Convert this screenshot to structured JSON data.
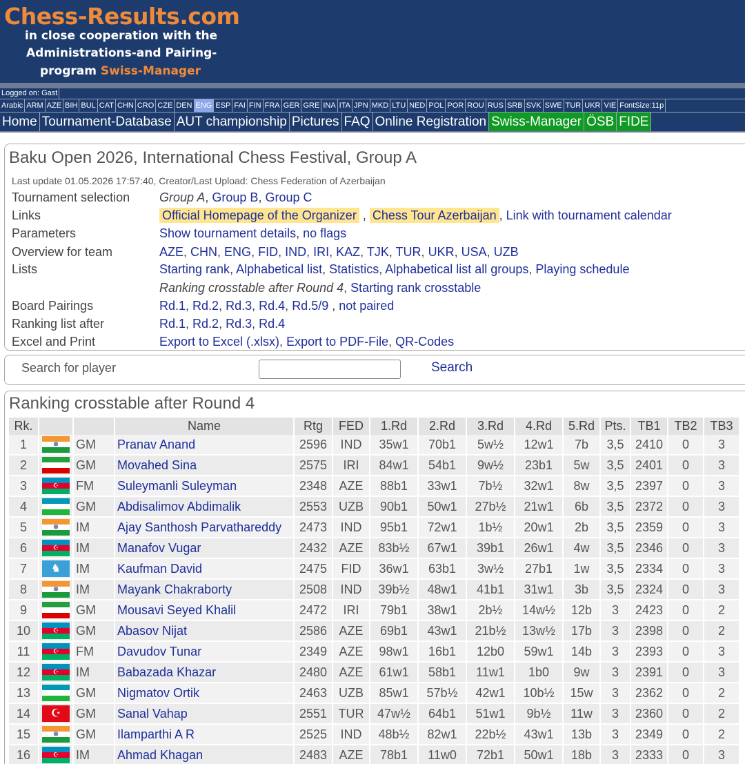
{
  "header": {
    "logo_title": "Chess-Results.com",
    "logo_line1": "in close cooperation with the",
    "logo_line2": "Administrations-and Pairing-",
    "logo_line3a": "program ",
    "logo_line3b": "Swiss-Manager"
  },
  "logon": "Logged on: Gast",
  "languages": [
    "Arabic",
    "ARM",
    "AZE",
    "BIH",
    "BUL",
    "CAT",
    "CHN",
    "CRO",
    "CZE",
    "DEN",
    "ENG",
    "ESP",
    "FAI",
    "FIN",
    "FRA",
    "GER",
    "GRE",
    "INA",
    "ITA",
    "JPN",
    "MKD",
    "LTU",
    "NED",
    "POL",
    "POR",
    "ROU",
    "RUS",
    "SRB",
    "SVK",
    "SWE",
    "TUR",
    "UKR",
    "VIE",
    "FontSize:11p"
  ],
  "active_language": "ENG",
  "menu": [
    "Home",
    "Tournament-Database",
    "AUT championship",
    "Pictures",
    "FAQ",
    "Online Registration",
    "Swiss-Manager",
    "ÖSB",
    "FIDE"
  ],
  "menu_green": [
    "Swiss-Manager",
    "ÖSB",
    "FIDE"
  ],
  "tournament": {
    "name": "Baku Open 2026, International Chess Festival, Group A",
    "last_update": "Last update 01.05.2026 17:57:40, Creator/Last Upload: Chess Federation of Azerbaijan",
    "rows": [
      {
        "label": "Tournament selection"
      },
      {
        "label": "Links"
      },
      {
        "label": "Parameters"
      },
      {
        "label": "Overview for team"
      },
      {
        "label": "Lists"
      },
      {
        "label": ""
      },
      {
        "label": "Board Pairings"
      },
      {
        "label": "Ranking list after"
      },
      {
        "label": "Excel and Print"
      }
    ],
    "selection_current": "Group A",
    "selection_links": [
      "Group B",
      "Group C"
    ],
    "links_highlight": [
      "Official Homepage of the Organizer",
      "Chess Tour Azerbaijan"
    ],
    "links_plain": "Link with tournament calendar",
    "parameters": [
      "Show tournament details",
      "no flags"
    ],
    "teams": [
      "AZE",
      "CHN",
      "ENG",
      "FID",
      "IND",
      "IRI",
      "KAZ",
      "TJK",
      "TUR",
      "UKR",
      "USA",
      "UZB"
    ],
    "lists": [
      "Starting rank",
      "Alphabetical list",
      "Statistics",
      "Alphabetical list all groups",
      "Playing schedule"
    ],
    "lists2_current": "Ranking crosstable after Round 4",
    "lists2_link": "Starting rank crosstable",
    "pairings": [
      "Rd.1",
      "Rd.2",
      "Rd.3",
      "Rd.4",
      "Rd.5/9"
    ],
    "pairings_extra": "not paired",
    "ranking_after": [
      "Rd.1",
      "Rd.2",
      "Rd.3",
      "Rd.4"
    ],
    "excel": [
      "Export to Excel (.xlsx)",
      "Export to PDF-File",
      "QR-Codes"
    ]
  },
  "search": {
    "label": "Search for player",
    "button": "Search",
    "value": ""
  },
  "crosstable": {
    "title": "Ranking crosstable after Round 4",
    "headers": [
      "Rk.",
      "",
      "",
      "Name",
      "Rtg",
      "FED",
      "1.Rd",
      "2.Rd",
      "3.Rd",
      "4.Rd",
      "5.Rd",
      "Pts.",
      "TB1",
      "TB2",
      "TB3"
    ],
    "rows": [
      {
        "rk": "1",
        "title": "GM",
        "name": "Pranav Anand",
        "rtg": "2596",
        "fed": "IND",
        "r1": "35w1",
        "r2": "70b1",
        "r3": "5w½",
        "r4": "12w1",
        "r5": "7b",
        "pts": "3,5",
        "tb1": "2410",
        "tb2": "0",
        "tb3": "3"
      },
      {
        "rk": "2",
        "title": "GM",
        "name": "Movahed Sina",
        "rtg": "2575",
        "fed": "IRI",
        "r1": "84w1",
        "r2": "54b1",
        "r3": "9w½",
        "r4": "23b1",
        "r5": "5w",
        "pts": "3,5",
        "tb1": "2401",
        "tb2": "0",
        "tb3": "3"
      },
      {
        "rk": "3",
        "title": "FM",
        "name": "Suleymanli Suleyman",
        "rtg": "2348",
        "fed": "AZE",
        "r1": "88b1",
        "r2": "33w1",
        "r3": "7b½",
        "r4": "32w1",
        "r5": "8w",
        "pts": "3,5",
        "tb1": "2397",
        "tb2": "0",
        "tb3": "3"
      },
      {
        "rk": "4",
        "title": "GM",
        "name": "Abdisalimov Abdimalik",
        "rtg": "2553",
        "fed": "UZB",
        "r1": "90b1",
        "r2": "50w1",
        "r3": "27b½",
        "r4": "21w1",
        "r5": "6b",
        "pts": "3,5",
        "tb1": "2372",
        "tb2": "0",
        "tb3": "3"
      },
      {
        "rk": "5",
        "title": "IM",
        "name": "Ajay Santhosh Parvathareddy",
        "rtg": "2473",
        "fed": "IND",
        "r1": "95b1",
        "r2": "72w1",
        "r3": "1b½",
        "r4": "20w1",
        "r5": "2b",
        "pts": "3,5",
        "tb1": "2359",
        "tb2": "0",
        "tb3": "3"
      },
      {
        "rk": "6",
        "title": "IM",
        "name": "Manafov Vugar",
        "rtg": "2432",
        "fed": "AZE",
        "r1": "83b½",
        "r2": "67w1",
        "r3": "39b1",
        "r4": "26w1",
        "r5": "4w",
        "pts": "3,5",
        "tb1": "2346",
        "tb2": "0",
        "tb3": "3"
      },
      {
        "rk": "7",
        "title": "IM",
        "name": "Kaufman David",
        "rtg": "2475",
        "fed": "FID",
        "r1": "36w1",
        "r2": "63b1",
        "r3": "3w½",
        "r4": "27b1",
        "r5": "1w",
        "pts": "3,5",
        "tb1": "2334",
        "tb2": "0",
        "tb3": "3"
      },
      {
        "rk": "8",
        "title": "IM",
        "name": "Mayank Chakraborty",
        "rtg": "2508",
        "fed": "IND",
        "r1": "39b½",
        "r2": "48w1",
        "r3": "41b1",
        "r4": "31w1",
        "r5": "3b",
        "pts": "3,5",
        "tb1": "2324",
        "tb2": "0",
        "tb3": "3"
      },
      {
        "rk": "9",
        "title": "GM",
        "name": "Mousavi Seyed Khalil",
        "rtg": "2472",
        "fed": "IRI",
        "r1": "79b1",
        "r2": "38w1",
        "r3": "2b½",
        "r4": "14w½",
        "r5": "12b",
        "pts": "3",
        "tb1": "2423",
        "tb2": "0",
        "tb3": "2"
      },
      {
        "rk": "10",
        "title": "GM",
        "name": "Abasov Nijat",
        "rtg": "2586",
        "fed": "AZE",
        "r1": "69b1",
        "r2": "43w1",
        "r3": "21b½",
        "r4": "13w½",
        "r5": "17b",
        "pts": "3",
        "tb1": "2398",
        "tb2": "0",
        "tb3": "2"
      },
      {
        "rk": "11",
        "title": "FM",
        "name": "Davudov Tunar",
        "rtg": "2349",
        "fed": "AZE",
        "r1": "98w1",
        "r2": "16b1",
        "r3": "12b0",
        "r4": "59w1",
        "r5": "14b",
        "pts": "3",
        "tb1": "2393",
        "tb2": "0",
        "tb3": "3"
      },
      {
        "rk": "12",
        "title": "IM",
        "name": "Babazada Khazar",
        "rtg": "2480",
        "fed": "AZE",
        "r1": "61w1",
        "r2": "58b1",
        "r3": "11w1",
        "r4": "1b0",
        "r5": "9w",
        "pts": "3",
        "tb1": "2391",
        "tb2": "0",
        "tb3": "3"
      },
      {
        "rk": "13",
        "title": "GM",
        "name": "Nigmatov Ortik",
        "rtg": "2463",
        "fed": "UZB",
        "r1": "85w1",
        "r2": "57b½",
        "r3": "42w1",
        "r4": "10b½",
        "r5": "15w",
        "pts": "3",
        "tb1": "2362",
        "tb2": "0",
        "tb3": "2"
      },
      {
        "rk": "14",
        "title": "GM",
        "name": "Sanal Vahap",
        "rtg": "2551",
        "fed": "TUR",
        "r1": "47w½",
        "r2": "64b1",
        "r3": "51w1",
        "r4": "9b½",
        "r5": "11w",
        "pts": "3",
        "tb1": "2360",
        "tb2": "0",
        "tb3": "2"
      },
      {
        "rk": "15",
        "title": "GM",
        "name": "Ilamparthi A R",
        "rtg": "2525",
        "fed": "IND",
        "r1": "48b½",
        "r2": "82w1",
        "r3": "22b½",
        "r4": "43w1",
        "r5": "13b",
        "pts": "3",
        "tb1": "2349",
        "tb2": "0",
        "tb3": "2"
      },
      {
        "rk": "16",
        "title": "IM",
        "name": "Ahmad Khagan",
        "rtg": "2483",
        "fed": "AZE",
        "r1": "78b1",
        "r2": "11w0",
        "r3": "72b1",
        "r4": "50w1",
        "r5": "18b",
        "pts": "3",
        "tb1": "2333",
        "tb2": "0",
        "tb3": "3"
      }
    ]
  },
  "flags": {
    "IND": {
      "bands": [
        "#f39733",
        "#ffffff",
        "#1a9a3a"
      ],
      "mark": "☸",
      "markColor": "#1a2f8a"
    },
    "IRI": {
      "bands": [
        "#239f40",
        "#ffffff",
        "#da0000"
      ],
      "mark": "",
      "markColor": "#da0000"
    },
    "AZE": {
      "bands": [
        "#0092bc",
        "#e4002b",
        "#00af66"
      ],
      "mark": "☪",
      "markColor": "#ffffff"
    },
    "UZB": {
      "bands": [
        "#0099b5",
        "#ffffff",
        "#1eb53a"
      ],
      "mark": "☾",
      "markColor": "#ffffff"
    },
    "FID": {
      "bands": [
        "#3aa0d8",
        "#3aa0d8",
        "#3aa0d8"
      ],
      "mark": "♞",
      "markColor": "#ffffff"
    },
    "TUR": {
      "bands": [
        "#e30a17",
        "#e30a17",
        "#e30a17"
      ],
      "mark": "☪",
      "markColor": "#ffffff"
    }
  }
}
